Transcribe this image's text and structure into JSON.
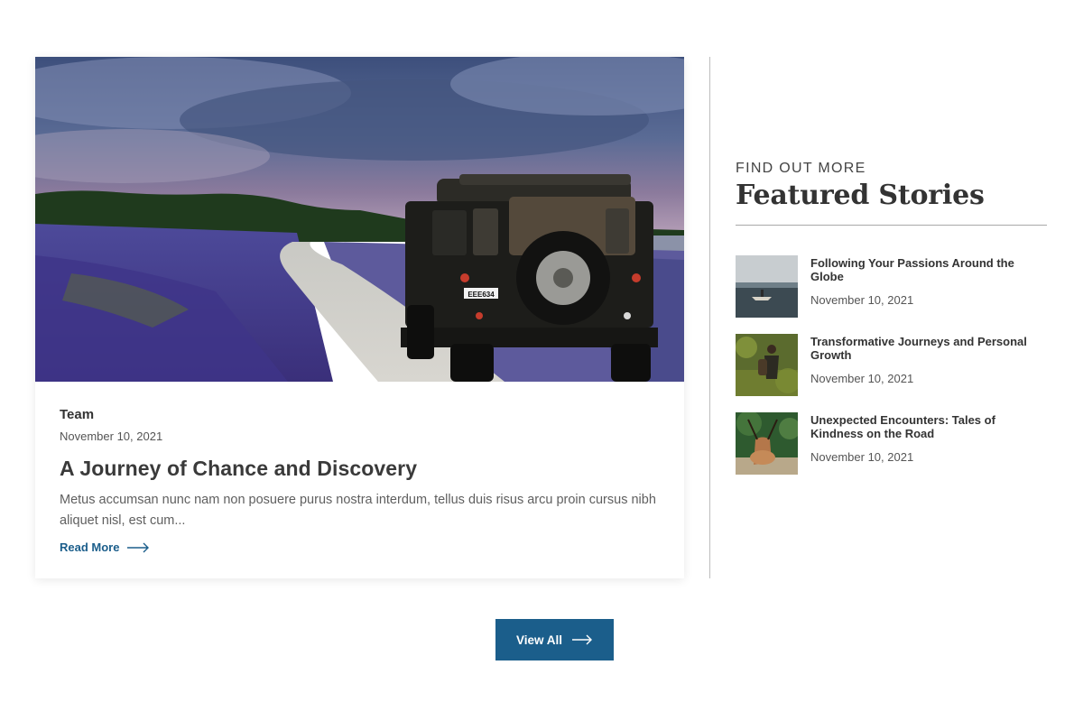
{
  "main_post": {
    "category": "Team",
    "date": "November 10, 2021",
    "title": "A Journey of Chance and Discovery",
    "excerpt": "Metus accumsan nunc nam non posuere purus nostra interdum, tellus duis risus arcu proin cursus nibh aliquet nisl, est cum...",
    "read_more_label": "Read More",
    "plate": "EEE634",
    "image_icon": "landscape-photo"
  },
  "sidebar": {
    "kicker": "FIND OUT MORE",
    "heading": "Featured Stories",
    "stories": [
      {
        "title": "Following Your Passions Around the Globe",
        "date": "November 10, 2021"
      },
      {
        "title": " Transformative Journeys and Personal Growth",
        "date": "November 10, 2021"
      },
      {
        "title": "Unexpected Encounters: Tales of Kindness on the Road",
        "date": "November 10, 2021"
      }
    ]
  },
  "view_all_label": "View All",
  "colors": {
    "accent": "#1b5e8b",
    "text": "#333333"
  }
}
